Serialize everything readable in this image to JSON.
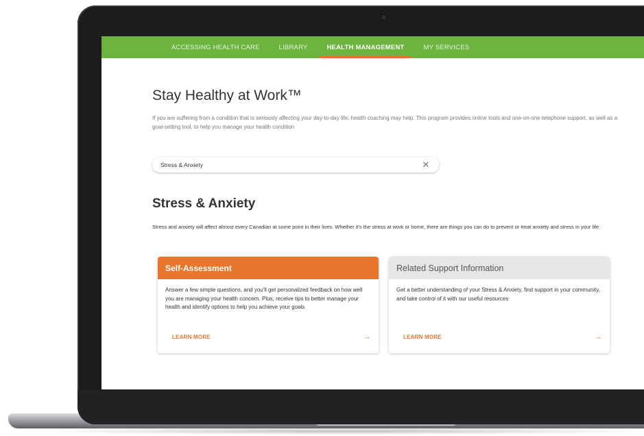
{
  "nav": {
    "items": [
      {
        "label": "ACCESSING HEALTH CARE"
      },
      {
        "label": "LIBRARY"
      },
      {
        "label": "HEALTH MANAGEMENT"
      },
      {
        "label": "MY SERVICES"
      }
    ],
    "active": "HEALTH MANAGEMENT"
  },
  "page": {
    "title": "Stay Healthy at Work™",
    "intro": "If you are suffering from a condition that is seriously affecting your day-to-day life, health coaching may help. This program provides online tools and one-on-one telephone support, as well as a goal-setting tool, to help you manage your health condition"
  },
  "search": {
    "value": "Stress & Anxiety",
    "clear_icon": "close-icon"
  },
  "section": {
    "title": "Stress & Anxiety",
    "intro": "Stress and anxiety will affect almost every Canadian at some point in their lives. Whether it's the stress at work or home, there are things you can do to prevent or treat anxiety and stress in your life."
  },
  "cards": [
    {
      "title": "Self-Assessment",
      "body": "Answer a few simple questions, and you'll get personalized feedback on how well you are managing your health concern. Plus, receive tips to better manage your health and identify options to help you achieve your goals",
      "link": "LEARN MORE",
      "arrow": "→"
    },
    {
      "title": "Related Support Information",
      "body": "Get a better understanding of your Stress & Anxiety, find support in your community, and take control of it with our useful resources",
      "link": "LEARN MORE",
      "arrow": "→"
    }
  ],
  "colors": {
    "nav_green": "#6db33f",
    "accent_orange": "#e8762d",
    "card_gray": "#e6e6e6"
  }
}
